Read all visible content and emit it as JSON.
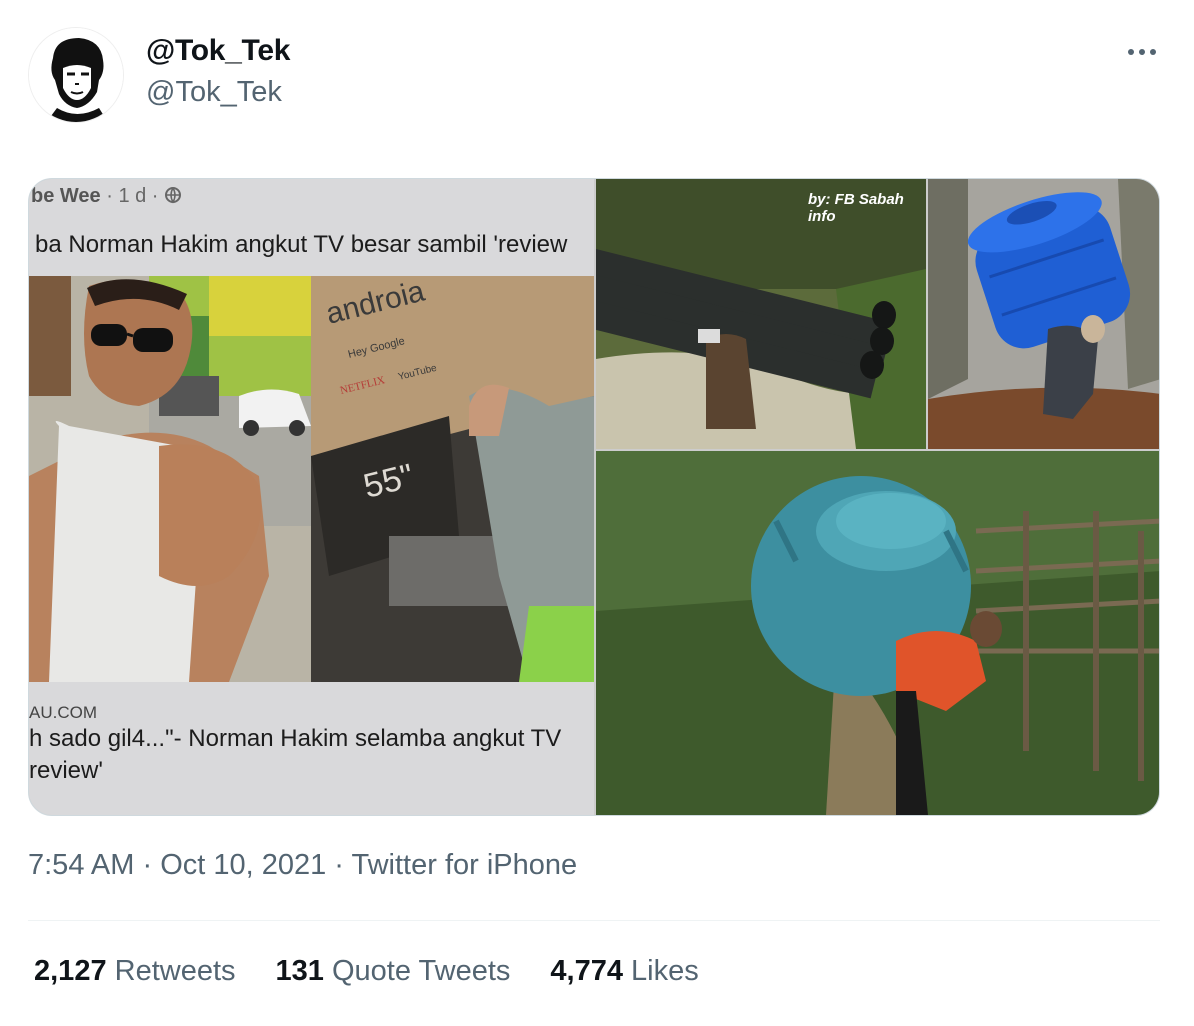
{
  "author": {
    "display_name": "@Tok_Tek",
    "handle": "@Tok_Tek"
  },
  "media": {
    "screenshot": {
      "meta_name": "be Wee",
      "meta_time": "· 1 d ·",
      "headline": "ba Norman Hakim angkut TV besar sambil 'review",
      "box_text": [
        "androia",
        "Hey Google",
        "NETFLIX",
        "YouTube",
        "55\""
      ],
      "link_domain": "AU.COM",
      "link_title_line1": "h sado gil4...\"- Norman Hakim selamba angkut TV",
      "link_title_line2": "review'"
    },
    "credit": "by: FB Sabah info"
  },
  "timestamp": {
    "time": "7:54 AM",
    "sep1": " · ",
    "date": "Oct 10, 2021",
    "sep2": " · ",
    "source": "Twitter for iPhone"
  },
  "stats": {
    "retweets_count": "2,127",
    "retweets_label": "Retweets",
    "quotes_count": "131",
    "quotes_label": "Quote Tweets",
    "likes_count": "4,774",
    "likes_label": "Likes"
  }
}
